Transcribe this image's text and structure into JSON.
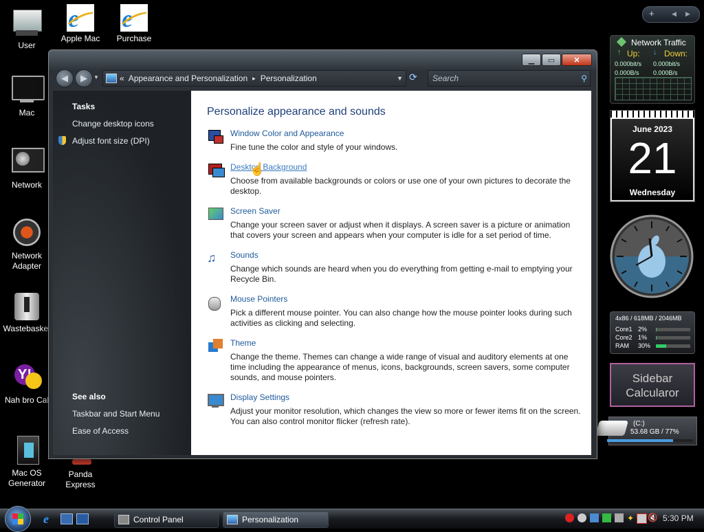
{
  "desktop_icons": [
    {
      "label": "User",
      "icon": "computer-icon"
    },
    {
      "label": "Apple Mac",
      "icon": "internet-explorer-icon"
    },
    {
      "label": "Purchase",
      "icon": "internet-explorer-icon"
    },
    {
      "label": "Mac",
      "icon": "monitor-icon"
    },
    {
      "label": "Network",
      "icon": "network-icon"
    },
    {
      "label": "Network\nAdapter",
      "icon": "network-adapter-icon"
    },
    {
      "label": "Wastebasket",
      "icon": "recycle-bin-icon"
    },
    {
      "label": "Nah bro Cal",
      "icon": "yahoo-messenger-icon"
    },
    {
      "label": "Mac OS\nGenerator",
      "icon": "folder-icon"
    },
    {
      "label": "Panda Express",
      "icon": "app-icon"
    }
  ],
  "gadgets": {
    "network": {
      "title": "Network Traffic",
      "up_label": "Up:",
      "down_label": "Down:",
      "up_bits": "0.000bit/s",
      "down_bits": "0.000bit/s",
      "up_bytes": "0.000B/s",
      "down_bytes": "0.000B/s"
    },
    "calendar": {
      "month_year": "June 2023",
      "day": "21",
      "weekday": "Wednesday"
    },
    "cpu": {
      "header": "4x86 / 618MB / 2046MB",
      "rows": [
        {
          "label": "Core1",
          "value": "2%",
          "fill": 0.02
        },
        {
          "label": "Core2",
          "value": "1%",
          "fill": 0.01
        },
        {
          "label": "RAM",
          "value": "30%",
          "fill": 0.3
        }
      ]
    },
    "calculator": {
      "label": "Sidebar Calcularor"
    },
    "drive": {
      "label": "(C:)",
      "value": "53.68 GB / 77%",
      "fill": 0.77
    }
  },
  "window": {
    "address": {
      "root_chevron": "«",
      "crumb1": "Appearance and Personalization",
      "sep": "▸",
      "crumb2": "Personalization"
    },
    "search_placeholder": "Search",
    "left": {
      "tasks_header": "Tasks",
      "tasks": [
        "Change desktop icons",
        "Adjust font size (DPI)"
      ],
      "see_also_header": "See also",
      "see_also": [
        "Taskbar and Start Menu",
        "Ease of Access"
      ]
    },
    "heading": "Personalize appearance and sounds",
    "items": [
      {
        "title": "Window Color and Appearance",
        "desc": "Fine tune the color and style of your windows."
      },
      {
        "title": "Desktop Background",
        "desc": "Choose from available backgrounds or colors or use one of your own pictures to decorate the desktop."
      },
      {
        "title": "Screen Saver",
        "desc": "Change your screen saver or adjust when it displays. A screen saver is a picture or animation that covers your screen and appears when your computer is idle for a set period of time."
      },
      {
        "title": "Sounds",
        "desc": "Change which sounds are heard when you do everything from getting e-mail to emptying your Recycle Bin."
      },
      {
        "title": "Mouse Pointers",
        "desc": "Pick a different mouse pointer. You can also change how the mouse pointer looks during such activities as clicking and selecting."
      },
      {
        "title": "Theme",
        "desc": "Change the theme. Themes can change a wide range of visual and auditory elements at one time including the appearance of menus, icons, backgrounds, screen savers, some computer sounds, and mouse pointers."
      },
      {
        "title": "Display Settings",
        "desc": "Adjust your monitor resolution, which changes the view so more or fewer items fit on the screen. You can also control monitor flicker (refresh rate)."
      }
    ]
  },
  "taskbar": {
    "buttons": [
      {
        "label": "Control Panel"
      },
      {
        "label": "Personalization"
      }
    ],
    "clock": "5:30 PM"
  },
  "colors": {
    "link": "#1e5a9a",
    "heading": "#1e3f7a",
    "close_button": "#c23418"
  }
}
